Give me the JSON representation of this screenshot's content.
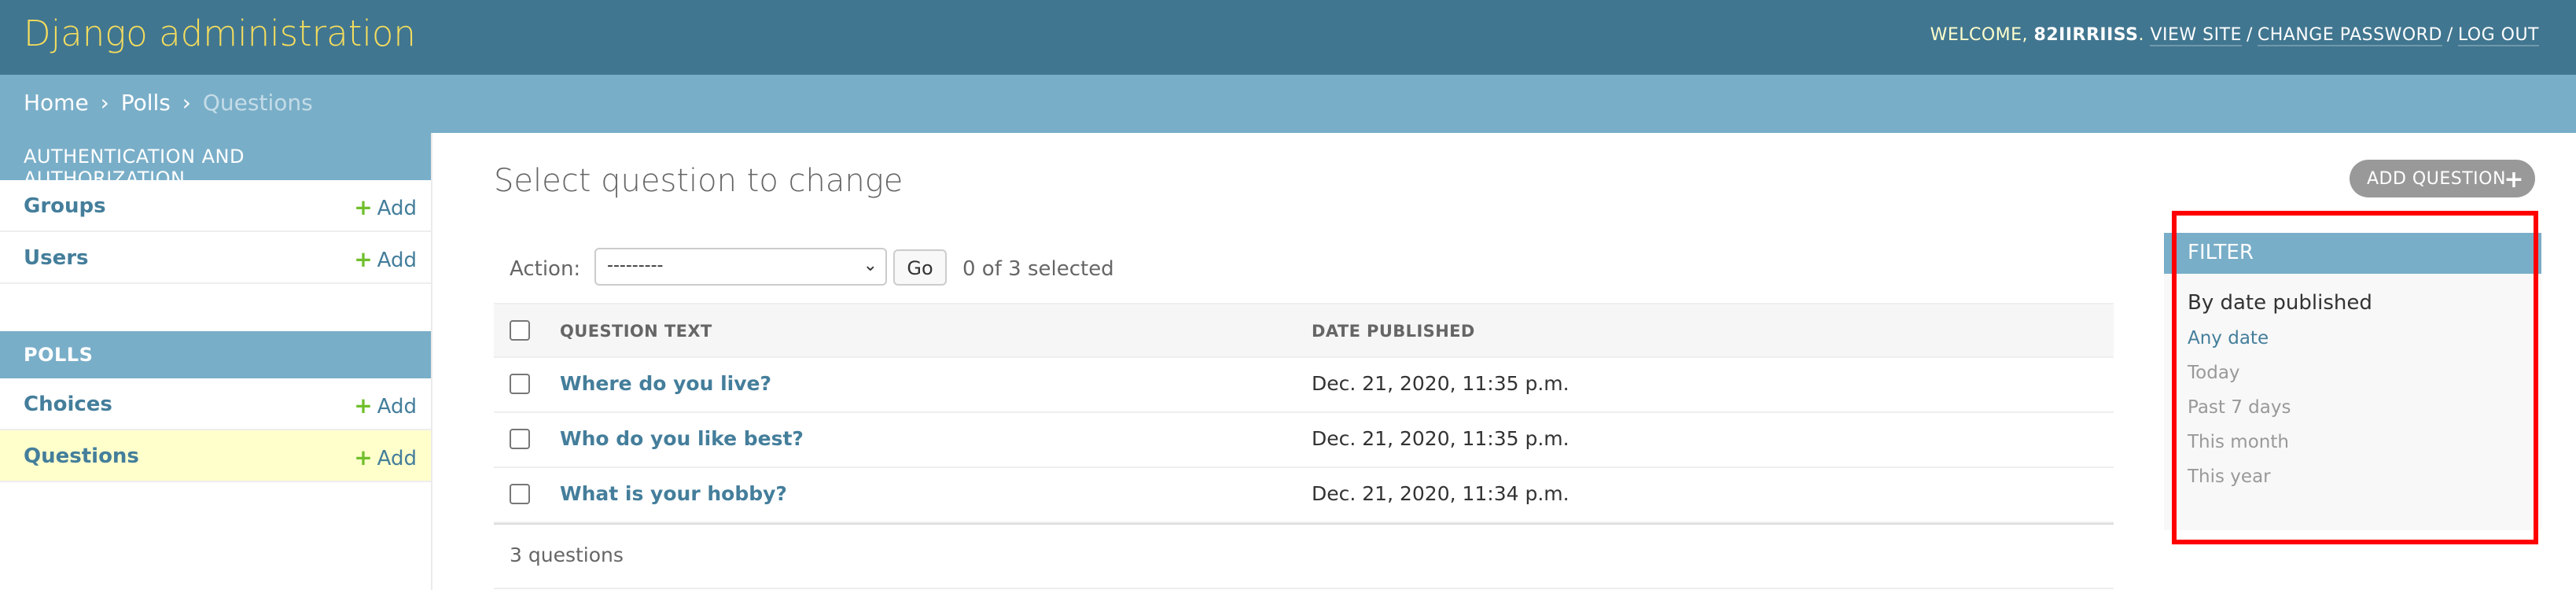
{
  "header": {
    "branding": "Django administration",
    "welcome": "WELCOME, ",
    "username": "82IIRRIISS",
    "view_site": "VIEW SITE",
    "change_password": "CHANGE PASSWORD",
    "log_out": "LOG OUT"
  },
  "breadcrumbs": {
    "home": "Home",
    "app": "Polls",
    "current": "Questions",
    "separator": "›"
  },
  "sidebar": {
    "apps": [
      {
        "caption": "AUTHENTICATION AND AUTHORIZATION",
        "models": [
          {
            "name": "Groups",
            "add": "Add"
          },
          {
            "name": "Users",
            "add": "Add"
          }
        ]
      },
      {
        "caption": "POLLS",
        "models": [
          {
            "name": "Choices",
            "add": "Add"
          },
          {
            "name": "Questions",
            "add": "Add"
          }
        ]
      }
    ]
  },
  "main": {
    "title": "Select question to change",
    "add_button": "ADD QUESTION",
    "actions": {
      "label": "Action:",
      "selected_value": "---------",
      "go": "Go",
      "selected_count": "0 of 3 selected"
    },
    "table": {
      "headers": [
        "QUESTION TEXT",
        "DATE PUBLISHED"
      ],
      "rows": [
        {
          "question": "Where do you live?",
          "date": "Dec. 21, 2020, 11:35 p.m."
        },
        {
          "question": "Who do you like best?",
          "date": "Dec. 21, 2020, 11:35 p.m."
        },
        {
          "question": "What is your hobby?",
          "date": "Dec. 21, 2020, 11:34 p.m."
        }
      ]
    },
    "paginator": "3 questions"
  },
  "filter": {
    "heading": "FILTER",
    "title": "By date published",
    "choices": [
      "Any date",
      "Today",
      "Past 7 days",
      "This month",
      "This year"
    ],
    "selected": "Any date"
  },
  "colors": {
    "header_bg": "#417690",
    "branding": "#f5dd5d",
    "breadcrumbs_bg": "#79aec8",
    "link": "#447e9b",
    "add_icon": "#70bf2b",
    "highlight_box": "#ff0000"
  },
  "icons": {
    "add": "plus-icon",
    "add_question": "plus-circle-icon",
    "select": "chevron-down-icon"
  }
}
